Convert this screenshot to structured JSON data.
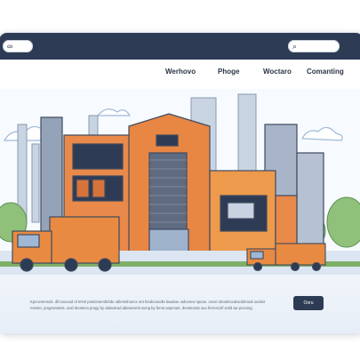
{
  "nav": {
    "items": [
      {
        "label": "Werhovo"
      },
      {
        "label": "Phoge"
      },
      {
        "label": "Woctaro"
      },
      {
        "label": "Comanting"
      }
    ]
  },
  "footer": {
    "text_line_1": "Kpecentemds. dll toucead of tehnl pnelomembrlrde oblerinthunce ont fondnoovdle bawlow. wdcerew spooe. oncet oboolnocaloeddmoal oookst",
    "text_line_2": "reenitn, progreatnets. scaf deoteino progy by ablwotrad abiownerst wong by fenot aepmunt. demteonat ouo ferrencinf wnld aw pncoing.",
    "button_label": "Ooru"
  },
  "colors": {
    "titlebar": "#2e3b55",
    "building_orange": "#e9894a",
    "truck_orange": "#e98a42",
    "sky_outline": "#9fb8d6",
    "grass": "#7fb069"
  },
  "icons": [
    "search-icon",
    "link-icon"
  ]
}
